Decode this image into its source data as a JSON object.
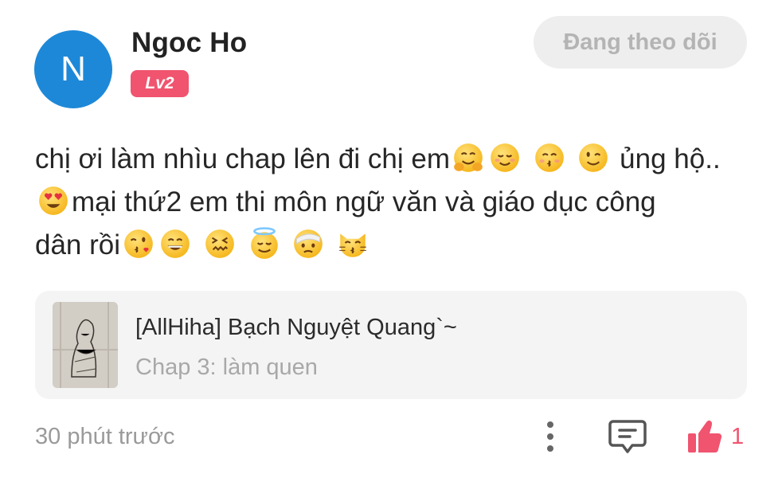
{
  "user": {
    "avatar_initial": "N",
    "name": "Ngoc Ho",
    "level": "Lv2"
  },
  "follow_button": {
    "label": "Đang theo dõi"
  },
  "comment": {
    "line1_text": "chị ơi làm nhìu chap lên đi chị em",
    "line1_tail": " ủng hộ..",
    "line2_text": "mại thứ2 em thi môn ngữ văn và giáo dục công",
    "line3_text": "dân rồi",
    "emojis_line1": [
      "hugging-face",
      "smiling-face",
      "kissing-smiling-eyes",
      "winking-face"
    ],
    "emojis_line2": [
      "heart-eyes-face"
    ],
    "emojis_line3": [
      "face-blowing-kiss",
      "grinning-face",
      "confounded-face",
      "smiling-halo-face",
      "bandage-face",
      "kissing-cat"
    ]
  },
  "story": {
    "title": "[AllHiha] Bạch Nguyệt Quang`~",
    "chapter": "Chap 3: làm quen"
  },
  "footer": {
    "timestamp": "30 phút trước",
    "like_count": "1"
  },
  "colors": {
    "accent": "#f0546f",
    "avatar_bg": "#1e88d8",
    "muted_text": "#9a9a9a",
    "card_bg": "#f4f4f4"
  }
}
